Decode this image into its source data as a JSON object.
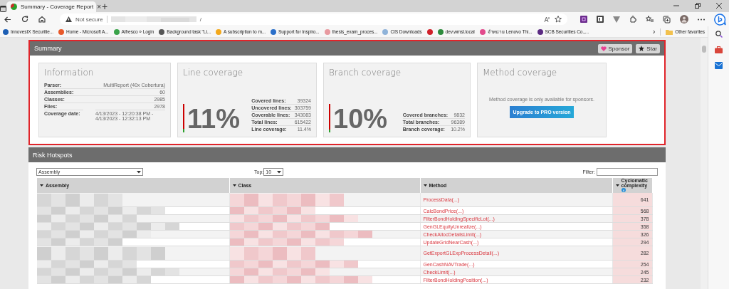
{
  "browser": {
    "tab": {
      "title": "Summary - Coverage Report",
      "close": "×",
      "selected": true
    },
    "new_tab": "+",
    "address": {
      "security": "Not secure",
      "url_tail": "/"
    },
    "bookmarks": [
      {
        "label": "InnovestX Securitie...",
        "color": "#1e5fb4"
      },
      {
        "label": "Home - Microsoft A...",
        "color": "#e8592a"
      },
      {
        "label": "Alfresco » Login",
        "color": "#3aa34a"
      },
      {
        "label": "Background task \"Li...",
        "color": "#555555"
      },
      {
        "label": "A subscription to m...",
        "color": "#f3a81b"
      },
      {
        "label": "Support for Inspiro...",
        "color": "#2a6fc9"
      },
      {
        "label": "thesis_exam_proces...",
        "color": "#e89aa0"
      },
      {
        "label": "CIS Downloads",
        "color": "#8fb3d9"
      },
      {
        "color": "#d0202a"
      },
      {
        "label": "dev.wmsl.local",
        "color": "#2c8a3c"
      },
      {
        "label": "จำหน่าย Lenovo Thi...",
        "color": "#e24a8c"
      },
      {
        "label": "SCB Securities Co.,...",
        "color": "#5a2a82"
      }
    ],
    "bookmarks_more": "›",
    "other_favorites": "Other favorites"
  },
  "summary": {
    "title": "Summary",
    "sponsor": "Sponsor",
    "star": "Star",
    "information": {
      "title": "Information",
      "rows": [
        {
          "label": "Parser:",
          "value": "MultiReport (40x Cobertura)"
        },
        {
          "label": "Assemblies:",
          "value": "60"
        },
        {
          "label": "Classes:",
          "value": "2985"
        },
        {
          "label": "Files:",
          "value": "2978"
        },
        {
          "label": "Coverage date:",
          "value": "4/13/2023 - 12:20:38 PM - 4/13/2023 - 12:32:13 PM"
        }
      ]
    },
    "line": {
      "title": "Line coverage",
      "percent": "11%",
      "level": 0.114,
      "rows": [
        {
          "label": "Covered lines:",
          "value": "39324"
        },
        {
          "label": "Uncovered lines:",
          "value": "303759"
        },
        {
          "label": "Coverable lines:",
          "value": "343083"
        },
        {
          "label": "Total lines:",
          "value": "615422"
        },
        {
          "label": "Line coverage:",
          "value": "11.4%"
        }
      ]
    },
    "branch": {
      "title": "Branch coverage",
      "percent": "10%",
      "level": 0.102,
      "rows": [
        {
          "label": "Covered branches:",
          "value": "9832"
        },
        {
          "label": "Total branches:",
          "value": "96389"
        },
        {
          "label": "Branch coverage:",
          "value": "10.2%"
        }
      ]
    },
    "method": {
      "title": "Method coverage",
      "note": "Method coverage is only available for sponsors.",
      "button": "Upgrade to PRO version"
    }
  },
  "hotspots": {
    "title": "Risk Hotspots",
    "group_by": "Assembly",
    "top_label": "Top:",
    "top_value": "10",
    "filter_label": "Filter:",
    "columns": [
      "Assembly",
      "Class",
      "Method",
      "Cyclomatic complexity"
    ],
    "rows": [
      {
        "method": "ProcessData(...)",
        "complexity": "641",
        "wrapped": true
      },
      {
        "method": "CalcBondPrice(...)",
        "complexity": "568",
        "wrapped": false
      },
      {
        "method": "FilterBondHoldingSpecificLot(...)",
        "complexity": "378",
        "wrapped": false
      },
      {
        "method": "GenGLEquityUnrealize(...)",
        "complexity": "358",
        "wrapped": false
      },
      {
        "method": "CheckAllocDetailsLimit(...)",
        "complexity": "326",
        "wrapped": false
      },
      {
        "method": "UpdateGridNearCash(...)",
        "complexity": "294",
        "wrapped": false
      },
      {
        "method": "GetExportGLExpProcessDetail(...)",
        "complexity": "282",
        "wrapped": true
      },
      {
        "method": "GenCashNAVTrade(...)",
        "complexity": "254",
        "wrapped": false
      },
      {
        "method": "CheckLimit(...)",
        "complexity": "245",
        "wrapped": false
      },
      {
        "method": "FilterBondHoldingPosition(...)",
        "complexity": "232",
        "wrapped": false
      }
    ]
  }
}
